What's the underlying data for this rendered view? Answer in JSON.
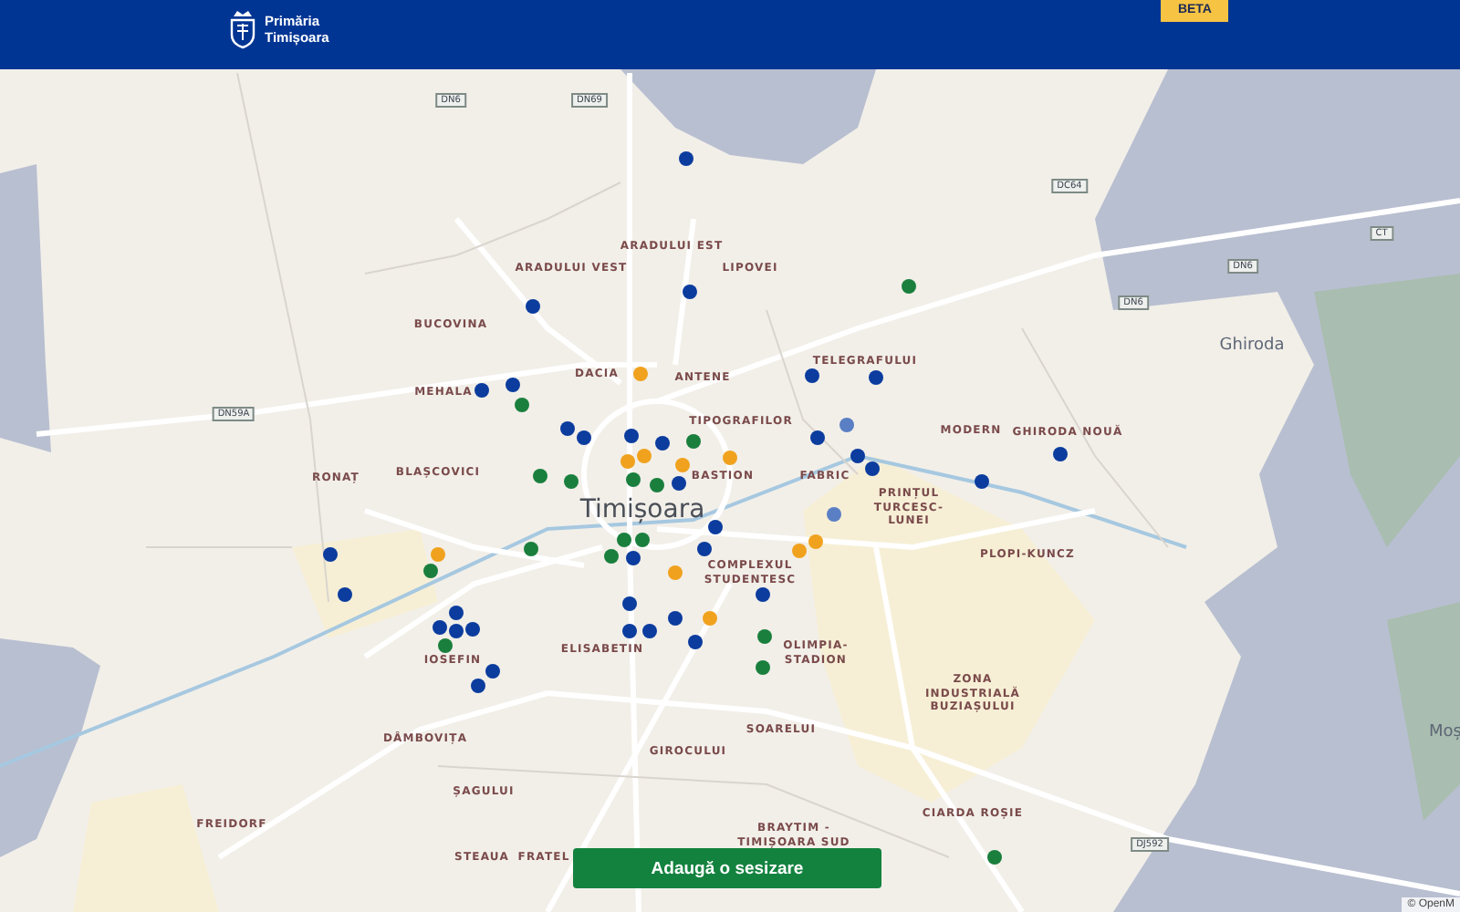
{
  "header": {
    "logo_line_1": "Primăria",
    "logo_line_2": "Timișoara",
    "badge": "BETA"
  },
  "map": {
    "place_labels": [
      {
        "text": "ARADULUI EST",
        "kind": "district"
      },
      {
        "text": "ARADULUI VEST",
        "kind": "district"
      },
      {
        "text": "LIPOVEI",
        "kind": "district"
      },
      {
        "text": "BUCOVINA",
        "kind": "district"
      },
      {
        "text": "DACIA",
        "kind": "district"
      },
      {
        "text": "ANTENE",
        "kind": "district"
      },
      {
        "text": "MEHALA",
        "kind": "district"
      },
      {
        "text": "TELEGRAFULUI",
        "kind": "district"
      },
      {
        "text": "TIPOGRAFILOR",
        "kind": "district"
      },
      {
        "text": "MODERN",
        "kind": "district"
      },
      {
        "text": "GHIRODA NOUĂ",
        "kind": "district"
      },
      {
        "text": "RONAȚ",
        "kind": "district"
      },
      {
        "text": "BLAȘCOVICI",
        "kind": "district"
      },
      {
        "text": "BASTION",
        "kind": "district"
      },
      {
        "text": "FABRIC",
        "kind": "district"
      },
      {
        "text": "Timișoara",
        "kind": "city"
      },
      {
        "text": "PRINȚUL TURCESC-LUNEI",
        "kind": "district"
      },
      {
        "text": "PLOPI-KUNCZ",
        "kind": "district"
      },
      {
        "text": "COMPLEXUL STUDENTESC",
        "kind": "district"
      },
      {
        "text": "OLIMPIA-STADION",
        "kind": "district"
      },
      {
        "text": "ZONA INDUSTRIALĂ BUZIAȘULUI",
        "kind": "district"
      },
      {
        "text": "IOSEFIN",
        "kind": "district"
      },
      {
        "text": "ELISABETIN",
        "kind": "district"
      },
      {
        "text": "DÂMBOVIȚA",
        "kind": "district"
      },
      {
        "text": "SOARELUI",
        "kind": "district"
      },
      {
        "text": "GIROCULUI",
        "kind": "district"
      },
      {
        "text": "ȘAGULUI",
        "kind": "district"
      },
      {
        "text": "CIARDA ROȘIE",
        "kind": "district"
      },
      {
        "text": "BRAYTIM - TIMIȘOARA SUD",
        "kind": "district"
      },
      {
        "text": "FREIDORF",
        "kind": "district"
      },
      {
        "text": "STEAUA",
        "kind": "district"
      },
      {
        "text": "FRATEL",
        "kind": "district"
      },
      {
        "text": "Ghiroda",
        "kind": "town"
      },
      {
        "text": "Moș",
        "kind": "town"
      }
    ],
    "road_labels": [
      "DN6",
      "DN69",
      "DC64",
      "CT",
      "DN6",
      "DN6",
      "DN59A",
      "DJ592"
    ],
    "pins": [
      {
        "color": "#0b3c9e"
      },
      {
        "color": "#0b3c9e"
      },
      {
        "color": "#0b3c9e"
      },
      {
        "color": "#1a7f3d"
      },
      {
        "color": "#0b3c9e"
      },
      {
        "color": "#0b3c9e"
      },
      {
        "color": "#1a7f3d"
      },
      {
        "color": "#f0a21e"
      },
      {
        "color": "#0b3c9e"
      },
      {
        "color": "#0b3c9e"
      },
      {
        "color": "#0b3c9e"
      },
      {
        "color": "#0b3c9e"
      },
      {
        "color": "#1a7f3d"
      },
      {
        "color": "#f0a21e"
      },
      {
        "color": "#0b3c9e"
      },
      {
        "color": "#0b3c9e"
      },
      {
        "color": "#0b3c9e"
      },
      {
        "color": "#5a7fc4"
      },
      {
        "color": "#1a7f3d"
      },
      {
        "color": "#1a7f3d"
      },
      {
        "color": "#f0a21e"
      },
      {
        "color": "#f0a21e"
      },
      {
        "color": "#1a7f3d"
      },
      {
        "color": "#f0a21e"
      },
      {
        "color": "#0b3c9e"
      },
      {
        "color": "#1a7f3d"
      },
      {
        "color": "#0b3c9e"
      },
      {
        "color": "#0b3c9e"
      },
      {
        "color": "#0b3c9e"
      },
      {
        "color": "#0b3c9e"
      },
      {
        "color": "#1a7f3d"
      },
      {
        "color": "#1a7f3d"
      },
      {
        "color": "#0b3c9e"
      },
      {
        "color": "#0b3c9e"
      },
      {
        "color": "#0b3c9e"
      },
      {
        "color": "#f0a21e"
      },
      {
        "color": "#1a7f3d"
      },
      {
        "color": "#1a7f3d"
      },
      {
        "color": "#0b3c9e"
      },
      {
        "color": "#f0a21e"
      },
      {
        "color": "#f0a21e"
      },
      {
        "color": "#f0a21e"
      },
      {
        "color": "#5a7fc4"
      },
      {
        "color": "#1a7f3d"
      },
      {
        "color": "#0b3c9e"
      },
      {
        "color": "#0b3c9e"
      },
      {
        "color": "#0b3c9e"
      },
      {
        "color": "#0b3c9e"
      },
      {
        "color": "#1a7f3d"
      },
      {
        "color": "#0b3c9e"
      },
      {
        "color": "#0b3c9e"
      },
      {
        "color": "#0b3c9e"
      },
      {
        "color": "#0b3c9e"
      },
      {
        "color": "#0b3c9e"
      },
      {
        "color": "#0b3c9e"
      },
      {
        "color": "#0b3c9e"
      },
      {
        "color": "#f0a21e"
      },
      {
        "color": "#0b3c9e"
      },
      {
        "color": "#0b3c9e"
      },
      {
        "color": "#1a7f3d"
      },
      {
        "color": "#1a7f3d"
      },
      {
        "color": "#1a7f3d"
      }
    ],
    "attribution": "© OpenM"
  },
  "action_button": "Adaugă o sesizare"
}
